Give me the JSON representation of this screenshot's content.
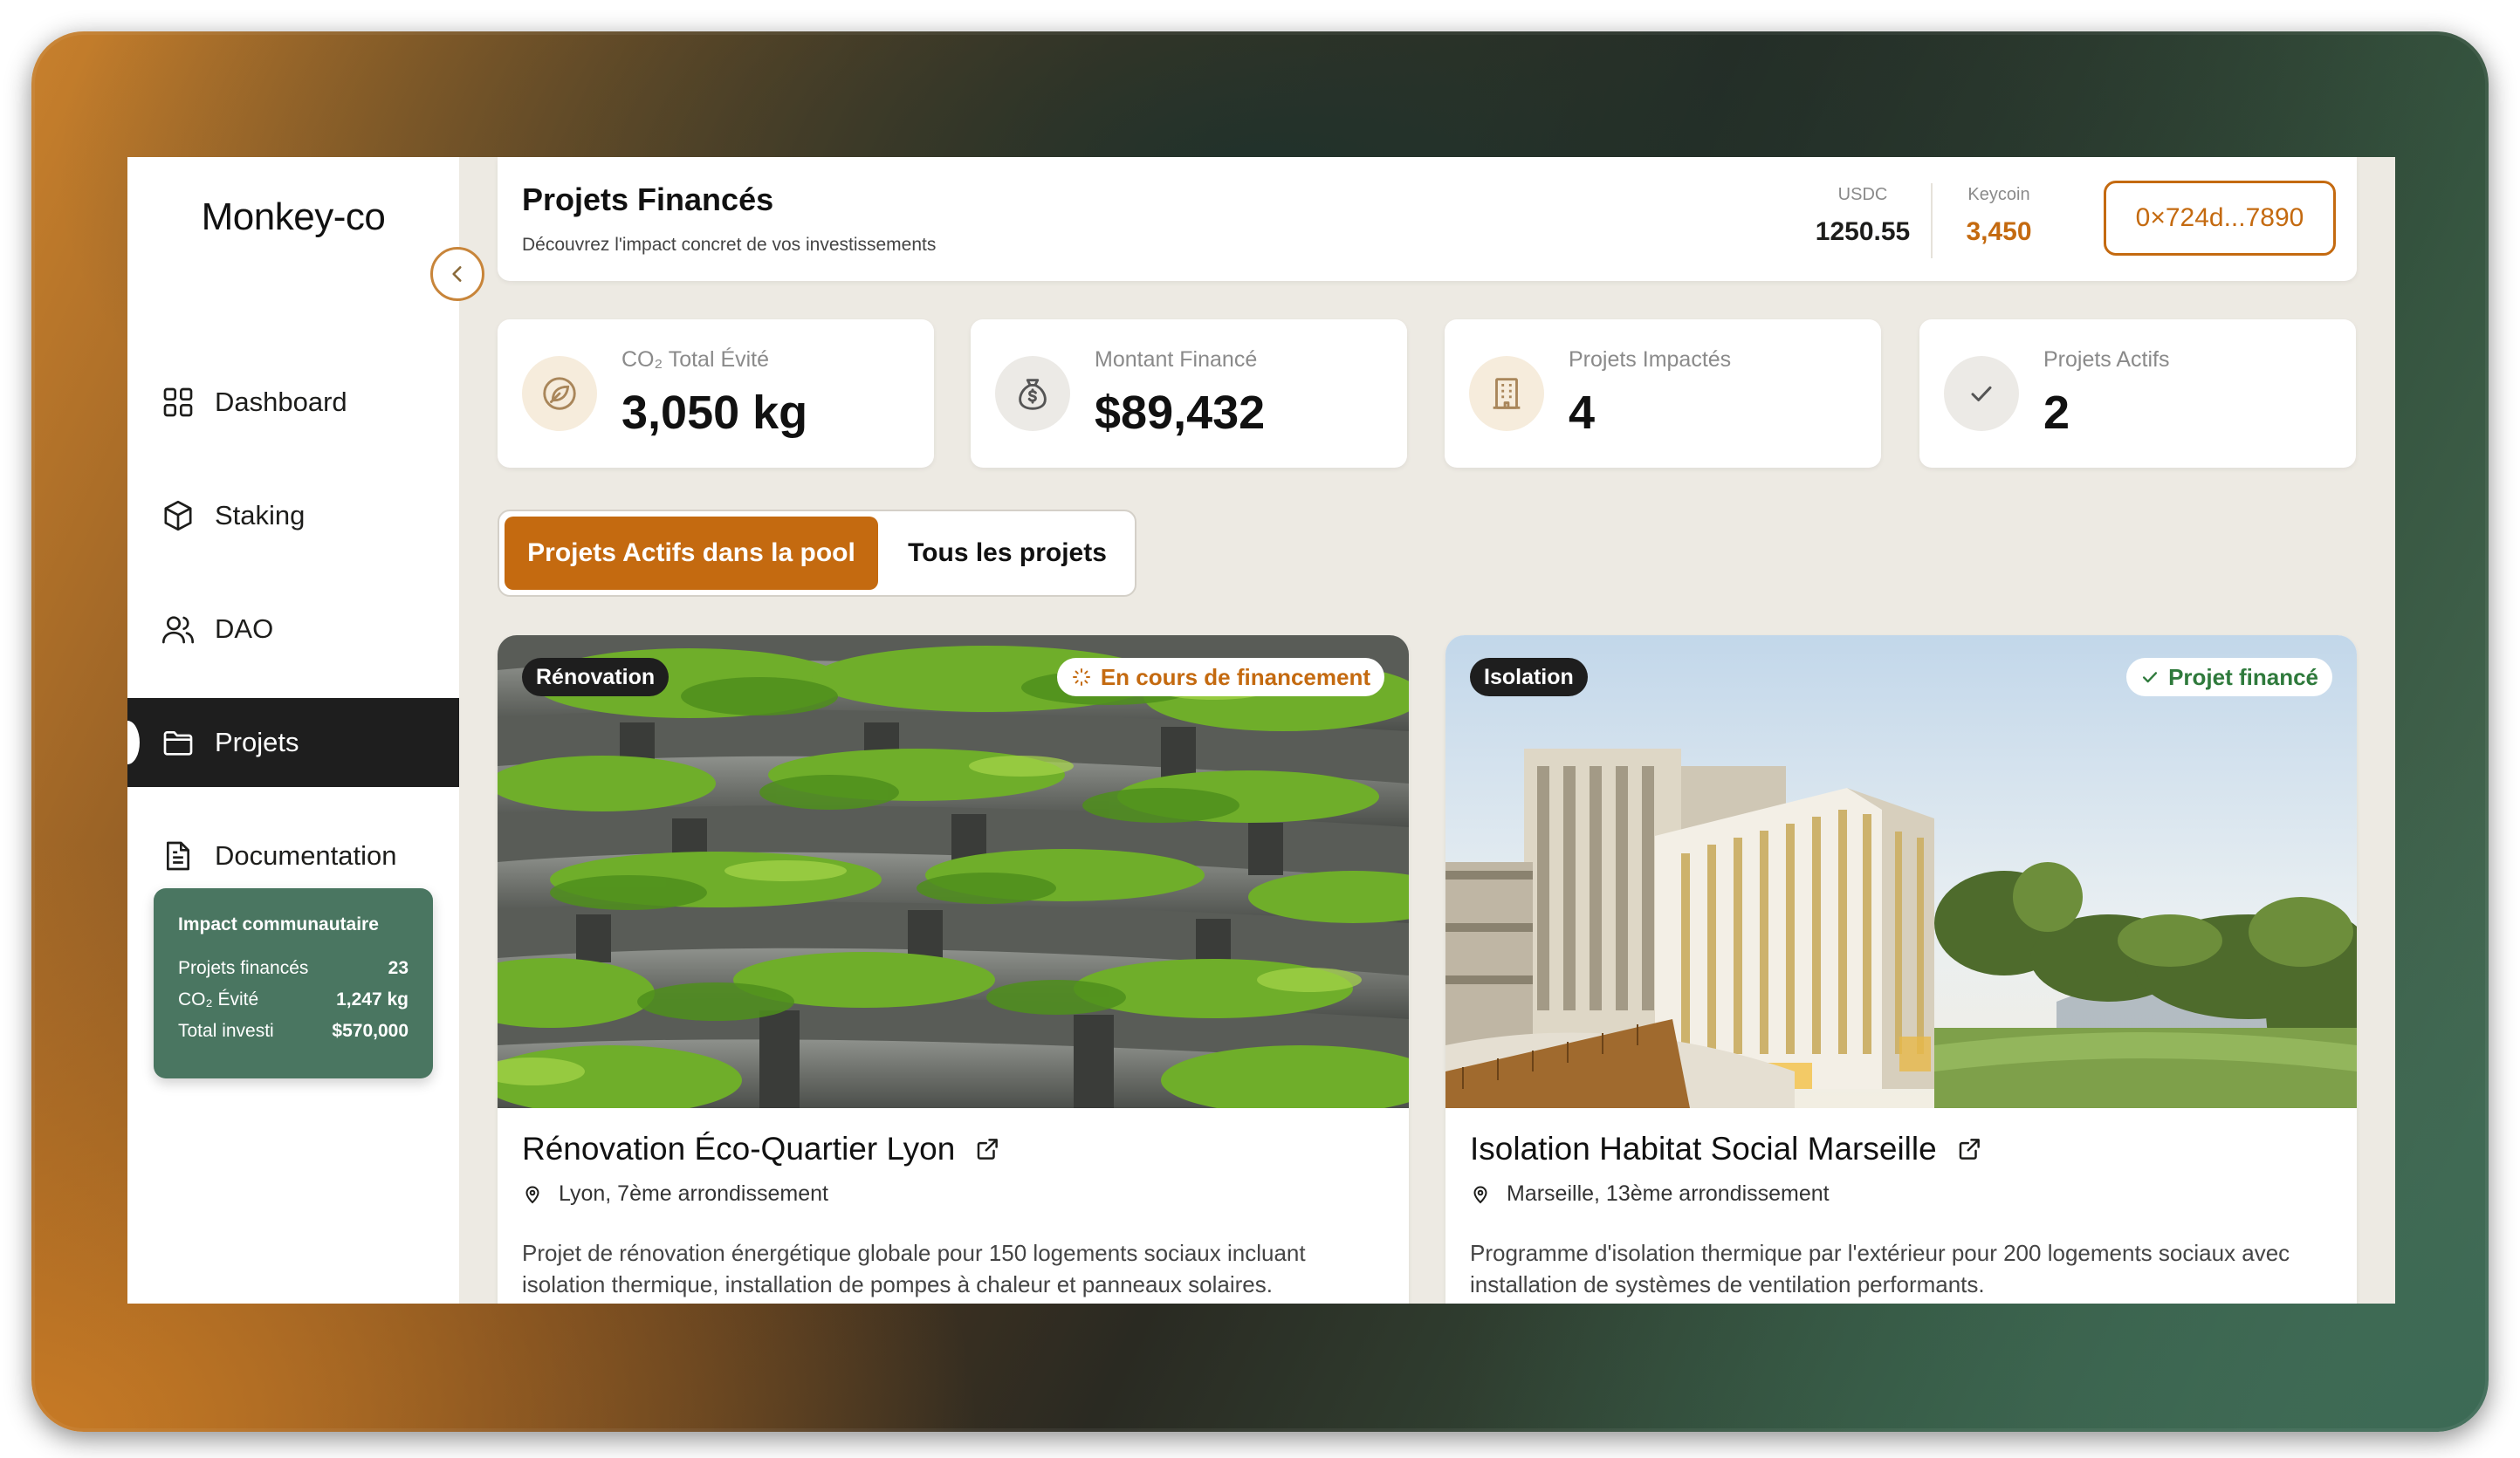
{
  "app": {
    "logo": "Monkey-co"
  },
  "sidebar": {
    "items": [
      {
        "label": "Dashboard",
        "icon": "dashboard-icon"
      },
      {
        "label": "Staking",
        "icon": "cube-icon"
      },
      {
        "label": "DAO",
        "icon": "users-icon"
      },
      {
        "label": "Projets",
        "icon": "folder-icon",
        "active": true
      },
      {
        "label": "Documentation",
        "icon": "document-icon"
      }
    ],
    "impact": {
      "title": "Impact communautaire",
      "rows": [
        {
          "label": "Projets financés",
          "value": "23"
        },
        {
          "label": "CO₂ Évité",
          "value": "1,247 kg"
        },
        {
          "label": "Total investi",
          "value": "$570,000"
        }
      ]
    }
  },
  "header": {
    "title": "Projets Financés",
    "subtitle": "Découvrez l'impact concret de vos investissements",
    "balances": [
      {
        "label": "USDC",
        "value": "1250.55"
      },
      {
        "label": "Keycoin",
        "value": "3,450"
      }
    ],
    "wallet": "0×724d...7890"
  },
  "stats": [
    {
      "label": "CO₂ Total Évité",
      "value": "3,050 kg",
      "icon": "leaf-icon"
    },
    {
      "label": "Montant Financé",
      "value": "$89,432",
      "icon": "money-bag-icon"
    },
    {
      "label": "Projets Impactés",
      "value": "4",
      "icon": "building-icon"
    },
    {
      "label": "Projets Actifs",
      "value": "2",
      "icon": "check-icon"
    }
  ],
  "tabs": [
    {
      "label": "Projets Actifs dans la pool",
      "active": true
    },
    {
      "label": "Tous les projets",
      "active": false
    }
  ],
  "projects": [
    {
      "category": "Rénovation",
      "status": "En cours de financement",
      "title": "Rénovation Éco-Quartier Lyon",
      "location": "Lyon, 7ème arrondissement",
      "description": "Projet de rénovation énergétique globale pour 150 logements sociaux incluant isolation thermique, installation de pompes à chaleur et panneaux solaires."
    },
    {
      "category": "Isolation",
      "status": "Projet financé",
      "title": "Isolation Habitat Social Marseille",
      "location": "Marseille, 13ème arrondissement",
      "description": "Programme d'isolation thermique par l'extérieur pour 200 logements sociaux avec installation de systèmes de ventilation performants."
    }
  ],
  "colors": {
    "accent": "#c46a10",
    "sidebar_active": "#1e1e1e",
    "impact_card": "#4a7661",
    "success": "#2f7a3c",
    "app_background": "#edeae3"
  }
}
